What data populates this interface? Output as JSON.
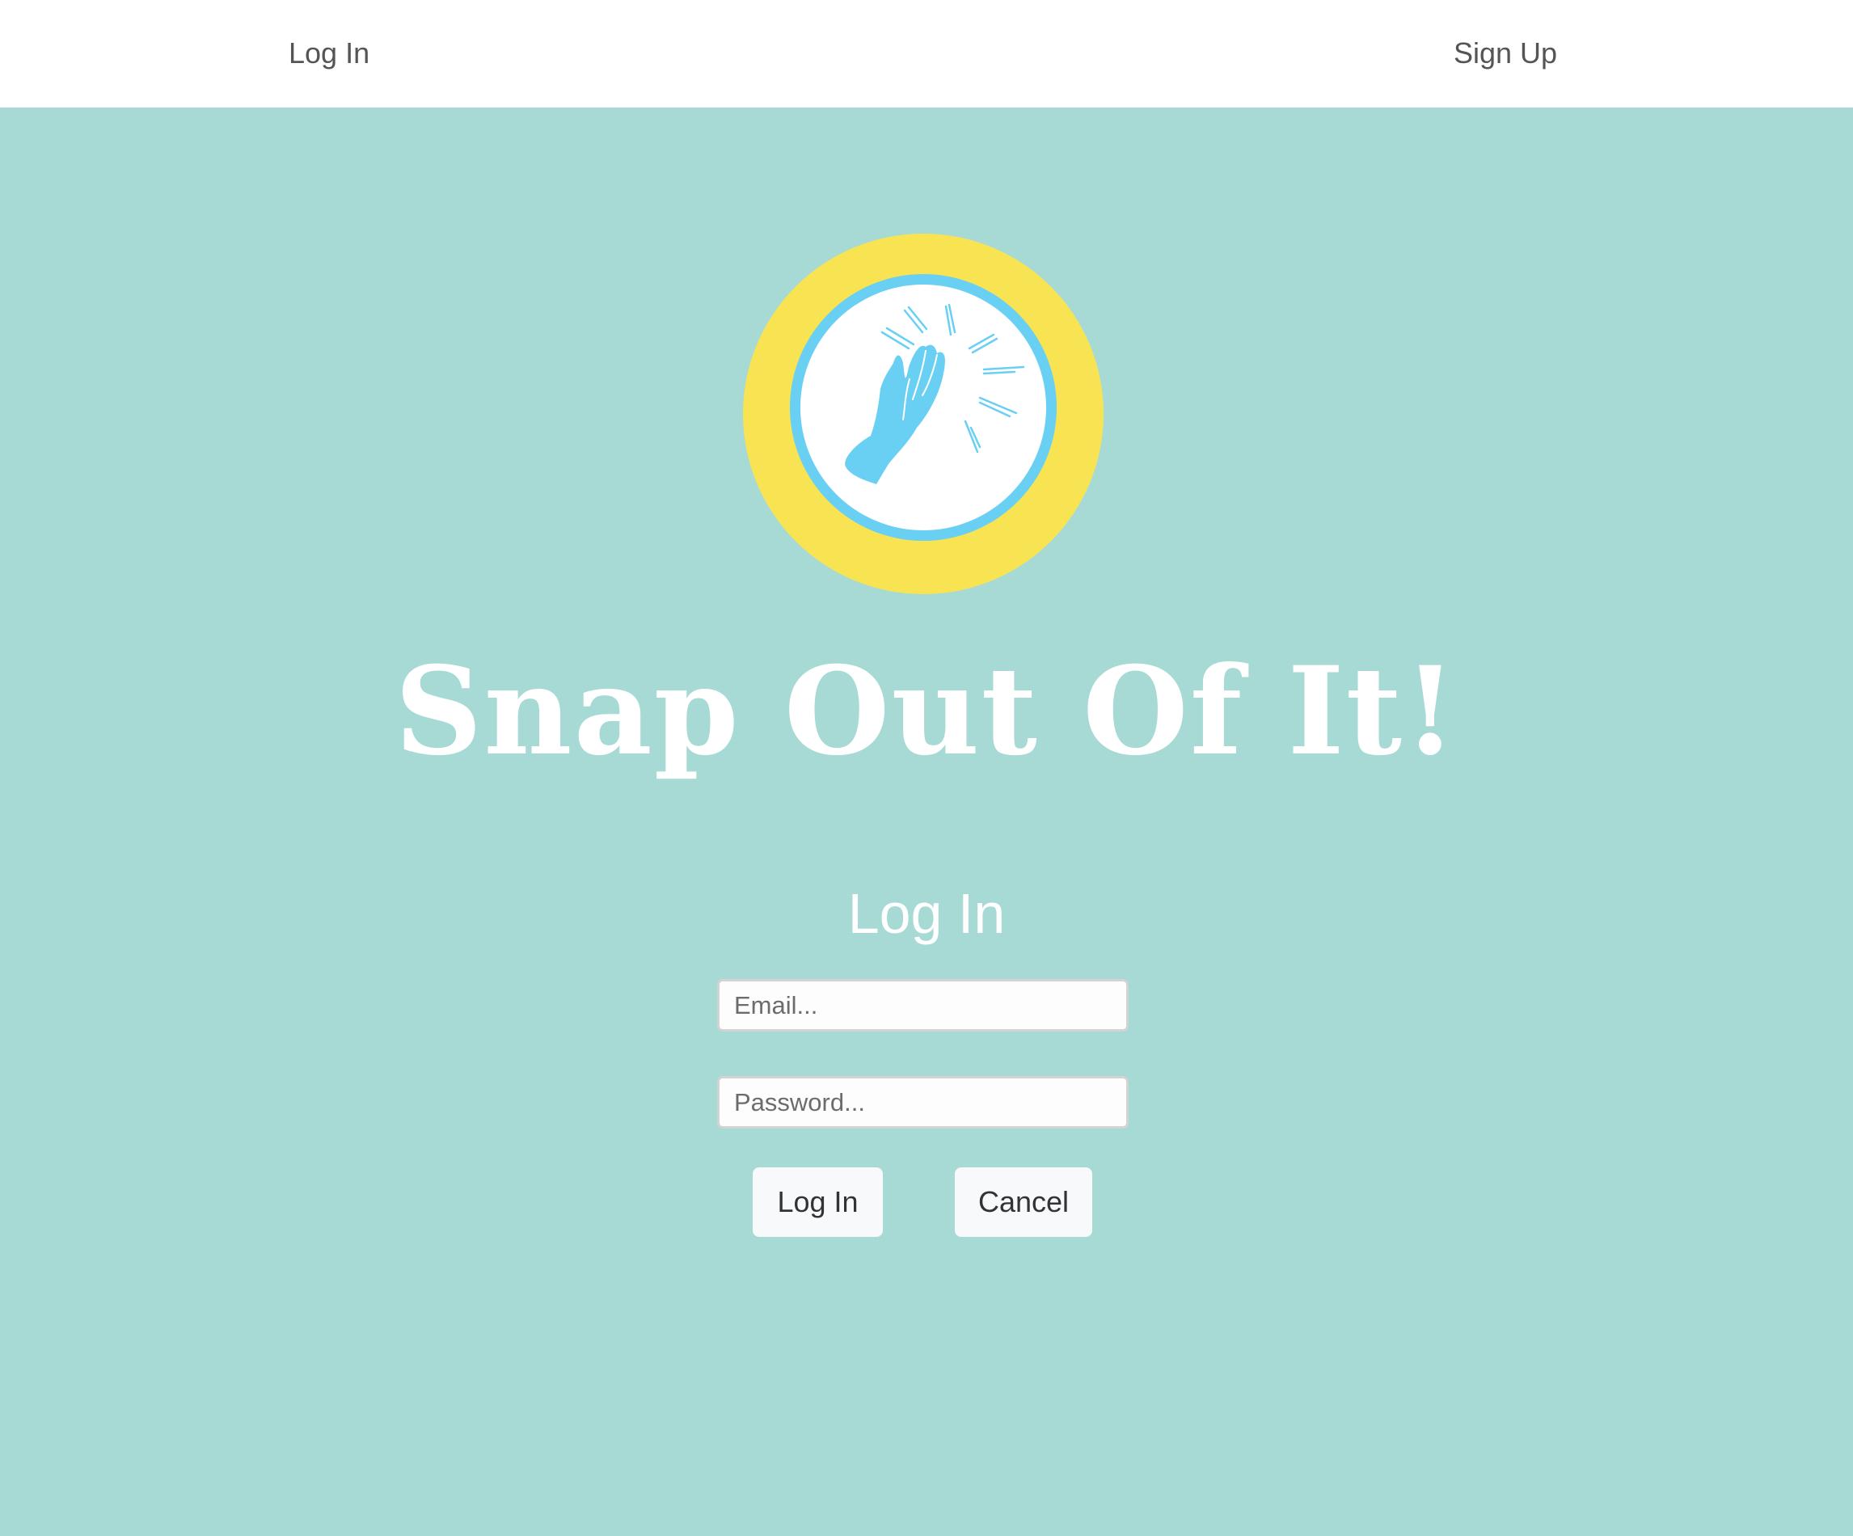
{
  "nav": {
    "login_label": "Log In",
    "signup_label": "Sign Up"
  },
  "brand": {
    "title": "Snap Out Of It!",
    "logo_icon": "high-five-hand-icon"
  },
  "form": {
    "heading": "Log In",
    "email": {
      "value": "",
      "placeholder": "Email..."
    },
    "password": {
      "value": "",
      "placeholder": "Password..."
    },
    "submit_label": "Log In",
    "cancel_label": "Cancel"
  },
  "colors": {
    "page_background": "#a8dad5",
    "nav_background": "#ffffff",
    "logo_outer_ring": "#f8e452",
    "logo_inner_ring": "#6ad0f3",
    "logo_center": "#ffffff",
    "hand": "#6ad0f3",
    "button_background": "#f8f9fa"
  }
}
